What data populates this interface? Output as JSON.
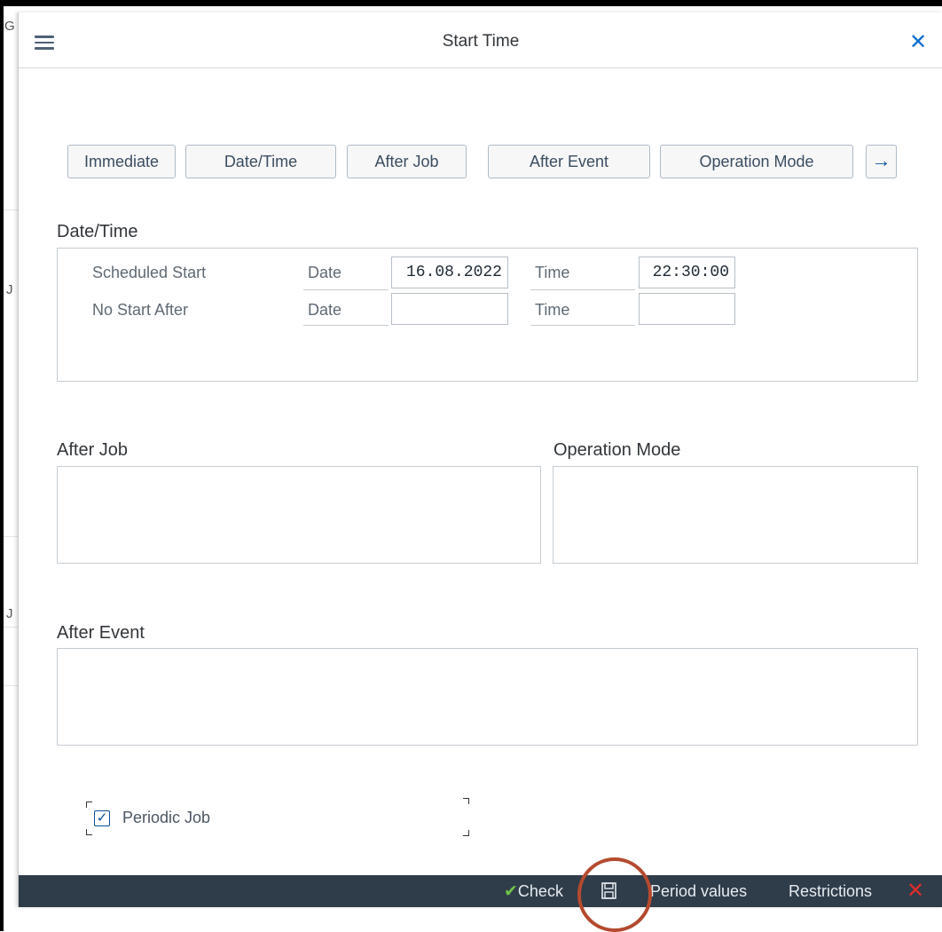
{
  "background": {
    "fragments": [
      "G",
      "J",
      "J"
    ]
  },
  "dialog": {
    "title": "Start Time"
  },
  "tabs": [
    "Immediate",
    "Date/Time",
    "After Job",
    "After Event",
    "Operation Mode"
  ],
  "datetime": {
    "title": "Date/Time",
    "rows": [
      {
        "label": "Scheduled Start",
        "date_label": "Date",
        "date_value": "16.08.2022",
        "time_label": "Time",
        "time_value": "22:30:00"
      },
      {
        "label": "No Start After",
        "date_label": "Date",
        "date_value": "",
        "time_label": "Time",
        "time_value": ""
      }
    ]
  },
  "groups": {
    "after_job": "After Job",
    "operation_mode": "Operation Mode",
    "after_event": "After Event"
  },
  "periodic": {
    "label": "Periodic Job",
    "checked": true
  },
  "footer": {
    "check": "Check",
    "period_values": "Period values",
    "restrictions": "Restrictions"
  },
  "colors": {
    "accent": "#0a6ed1",
    "footer_bg": "#2f3c49",
    "cancel": "#e02b2b",
    "check": "#6dc24b",
    "highlight_ring": "#b44a2e"
  }
}
